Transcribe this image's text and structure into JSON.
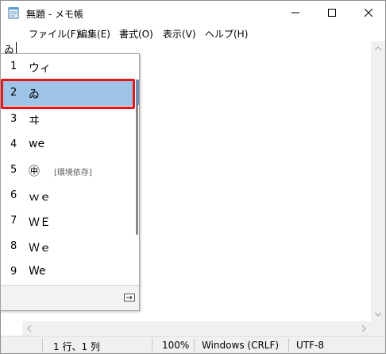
{
  "window": {
    "title": "無題 - メモ帳",
    "icons": {
      "app": "notepad-icon",
      "min": "minimize-icon",
      "max": "maximize-icon",
      "close": "close-icon"
    }
  },
  "menu": [
    "ファイル(F)",
    "編集(E)",
    "書式(O)",
    "表示(V)",
    "ヘルプ(H)"
  ],
  "editor": {
    "composition_text": "ゐ"
  },
  "ime": {
    "candidates": [
      {
        "num": "1",
        "text": "ウィ",
        "note": ""
      },
      {
        "num": "2",
        "text": "ゐ",
        "note": ""
      },
      {
        "num": "3",
        "text": "ヰ",
        "note": ""
      },
      {
        "num": "4",
        "text": "we",
        "note": ""
      },
      {
        "num": "5",
        "text": "㊙",
        "note": "[環境依存]"
      },
      {
        "num": "6",
        "text": "ｗｅ",
        "note": ""
      },
      {
        "num": "7",
        "text": "ＷＥ",
        "note": ""
      },
      {
        "num": "8",
        "text": "Ｗｅ",
        "note": ""
      },
      {
        "num": "9",
        "text": "We",
        "note": ""
      }
    ],
    "selected_index": 2,
    "candidate_5_glyph": "㊥",
    "footer_icon": "expand-view-icon"
  },
  "status": {
    "position": "1 行、1 列",
    "zoom": "100%",
    "line_ending": "Windows (CRLF)",
    "encoding": "UTF-8"
  },
  "colors": {
    "selection": "#9dc3e6",
    "highlight_border": "#e8161b",
    "chrome": "#f0f0f0"
  }
}
